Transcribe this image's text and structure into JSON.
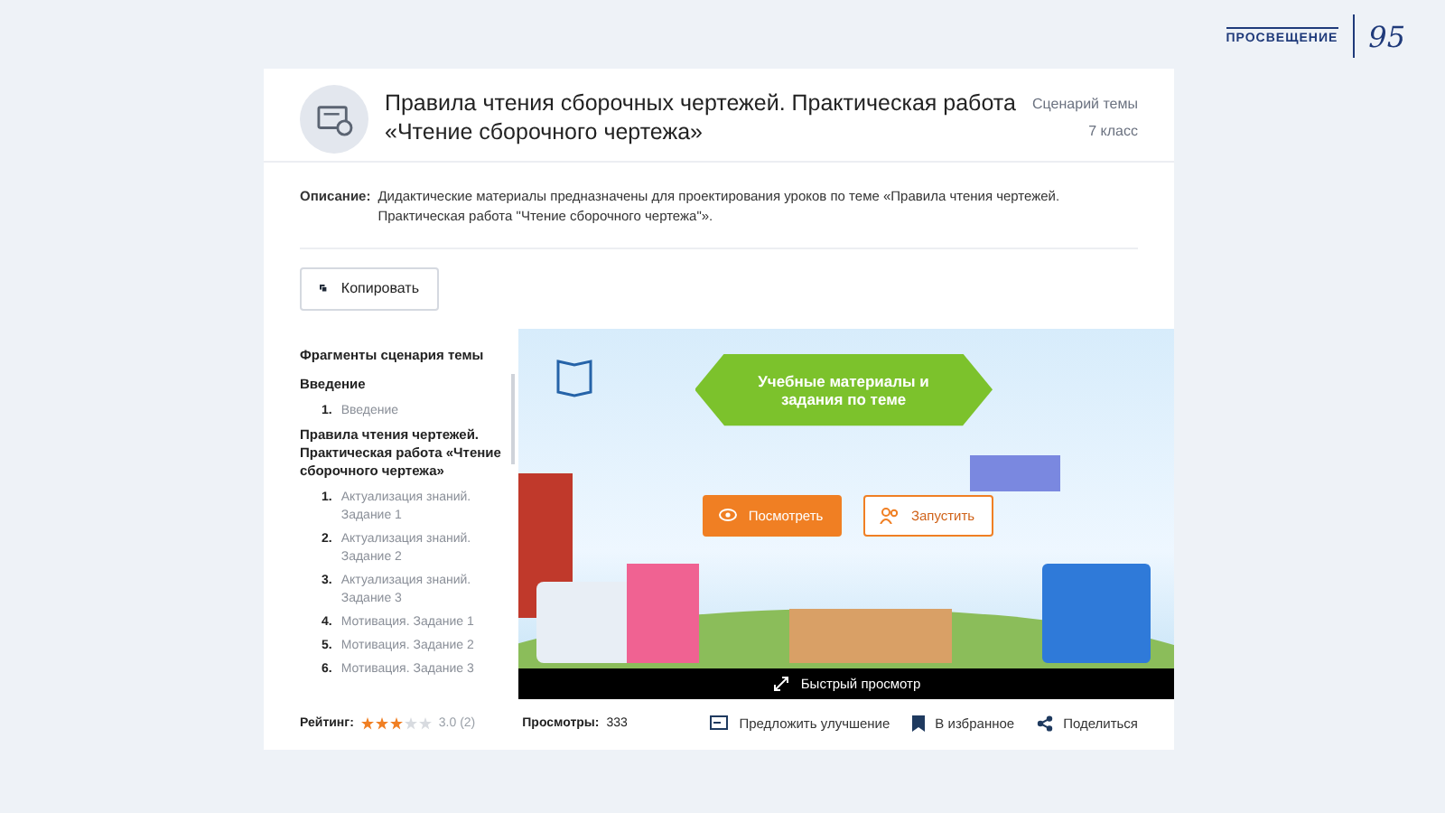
{
  "brand": {
    "name": "ПРОСВЕЩЕНИЕ",
    "anniversary": "95"
  },
  "header": {
    "title": "Правила чтения сборочных чертежей. Практическая работа «Чтение сборочного чертежа»",
    "type": "Сценарий темы",
    "grade": "7 класс"
  },
  "description": {
    "label": "Описание:",
    "text": "Дидактические материалы предназначены для проектирования уроков по теме «Правила чтения чертежей. Практическая работа \"Чтение сборочного чертежа\"»."
  },
  "copy_button": "Копировать",
  "sidebar": {
    "title": "Фрагменты сценария темы",
    "sections": [
      {
        "title": "Введение",
        "items": [
          {
            "number": "1.",
            "label": "Введение"
          }
        ]
      },
      {
        "title": "Правила чтения чертежей. Практическая работа «Чтение сборочного чертежа»",
        "items": [
          {
            "number": "1.",
            "label": "Актуализация знаний. Задание 1"
          },
          {
            "number": "2.",
            "label": "Актуализация знаний. Задание 2"
          },
          {
            "number": "3.",
            "label": "Актуализация знаний. Задание 3"
          },
          {
            "number": "4.",
            "label": "Мотивация. Задание 1"
          },
          {
            "number": "5.",
            "label": "Мотивация. Задание 2"
          },
          {
            "number": "6.",
            "label": "Мотивация. Задание 3"
          }
        ]
      }
    ]
  },
  "preview": {
    "banner": "Учебные материалы и задания по теме",
    "view_button": "Посмотреть",
    "launch_button": "Запустить",
    "quick_view": "Быстрый просмотр"
  },
  "footer": {
    "rating_label": "Рейтинг:",
    "stars": 3,
    "rating": "3.0 (2)",
    "views_label": "Просмотры:",
    "views": "333",
    "suggest": "Предложить улучшение",
    "favorite": "В избранное",
    "share": "Поделиться"
  }
}
